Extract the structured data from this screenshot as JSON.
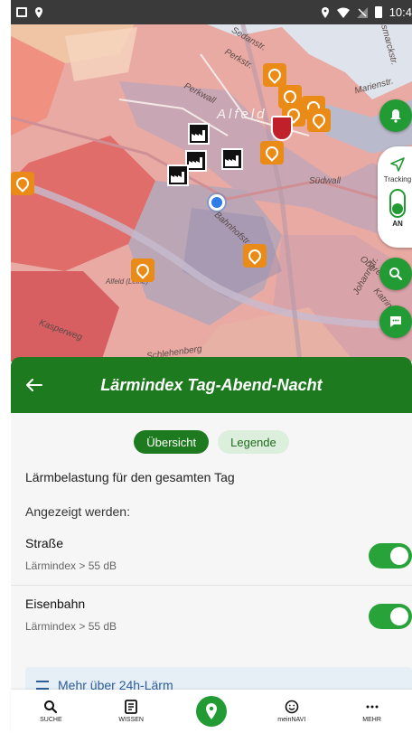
{
  "status_bar": {
    "time": "10:4"
  },
  "map": {
    "town_label": "Alfeld",
    "street_labels": {
      "perkstr": "Perkstr.",
      "perkwall": "Perkwall",
      "sedan": "Sedanstr.",
      "bahnhof": "Bahnhofstr.",
      "sudwall": "Südwall",
      "kasper": "Kasperweg",
      "schlehen": "Schlehenberg",
      "station": "Alfeld (Leine)",
      "marien": "Marienstr.",
      "bismarck": "Bismarckstr.",
      "johann": "Johannstr.",
      "ober": "Oberer",
      "katrin": "Katrinstr."
    },
    "tracking": {
      "label": "Tracking",
      "state": "AN"
    }
  },
  "sheet": {
    "title": "Lärmindex Tag-Abend-Nacht",
    "tabs": [
      {
        "label": "Übersicht",
        "active": true
      },
      {
        "label": "Legende",
        "active": false
      }
    ],
    "subtitle": "Lärmbelastung für den gesamten Tag",
    "shown_label": "Angezeigt werden:",
    "rows": [
      {
        "title": "Straße",
        "subtitle": "Lärmindex > 55 dB",
        "enabled": true
      },
      {
        "title": "Eisenbahn",
        "subtitle": "Lärmindex > 55 dB",
        "enabled": true
      }
    ],
    "more_link": "Mehr über 24h-Lärm"
  },
  "bottom_nav": {
    "items": [
      {
        "label": "SUCHE",
        "icon": "search-icon"
      },
      {
        "label": "WISSEN",
        "icon": "document-icon"
      },
      {
        "label": "",
        "icon": "map-pin-icon"
      },
      {
        "label": "meinNAVI",
        "icon": "smiley-icon"
      },
      {
        "label": "MEHR",
        "icon": "more-dots-icon"
      }
    ]
  },
  "colors": {
    "primary_green": "#1e7a1e",
    "fab_green": "#239b34",
    "poi_orange": "#e98b16",
    "location_blue": "#2f7be8"
  }
}
